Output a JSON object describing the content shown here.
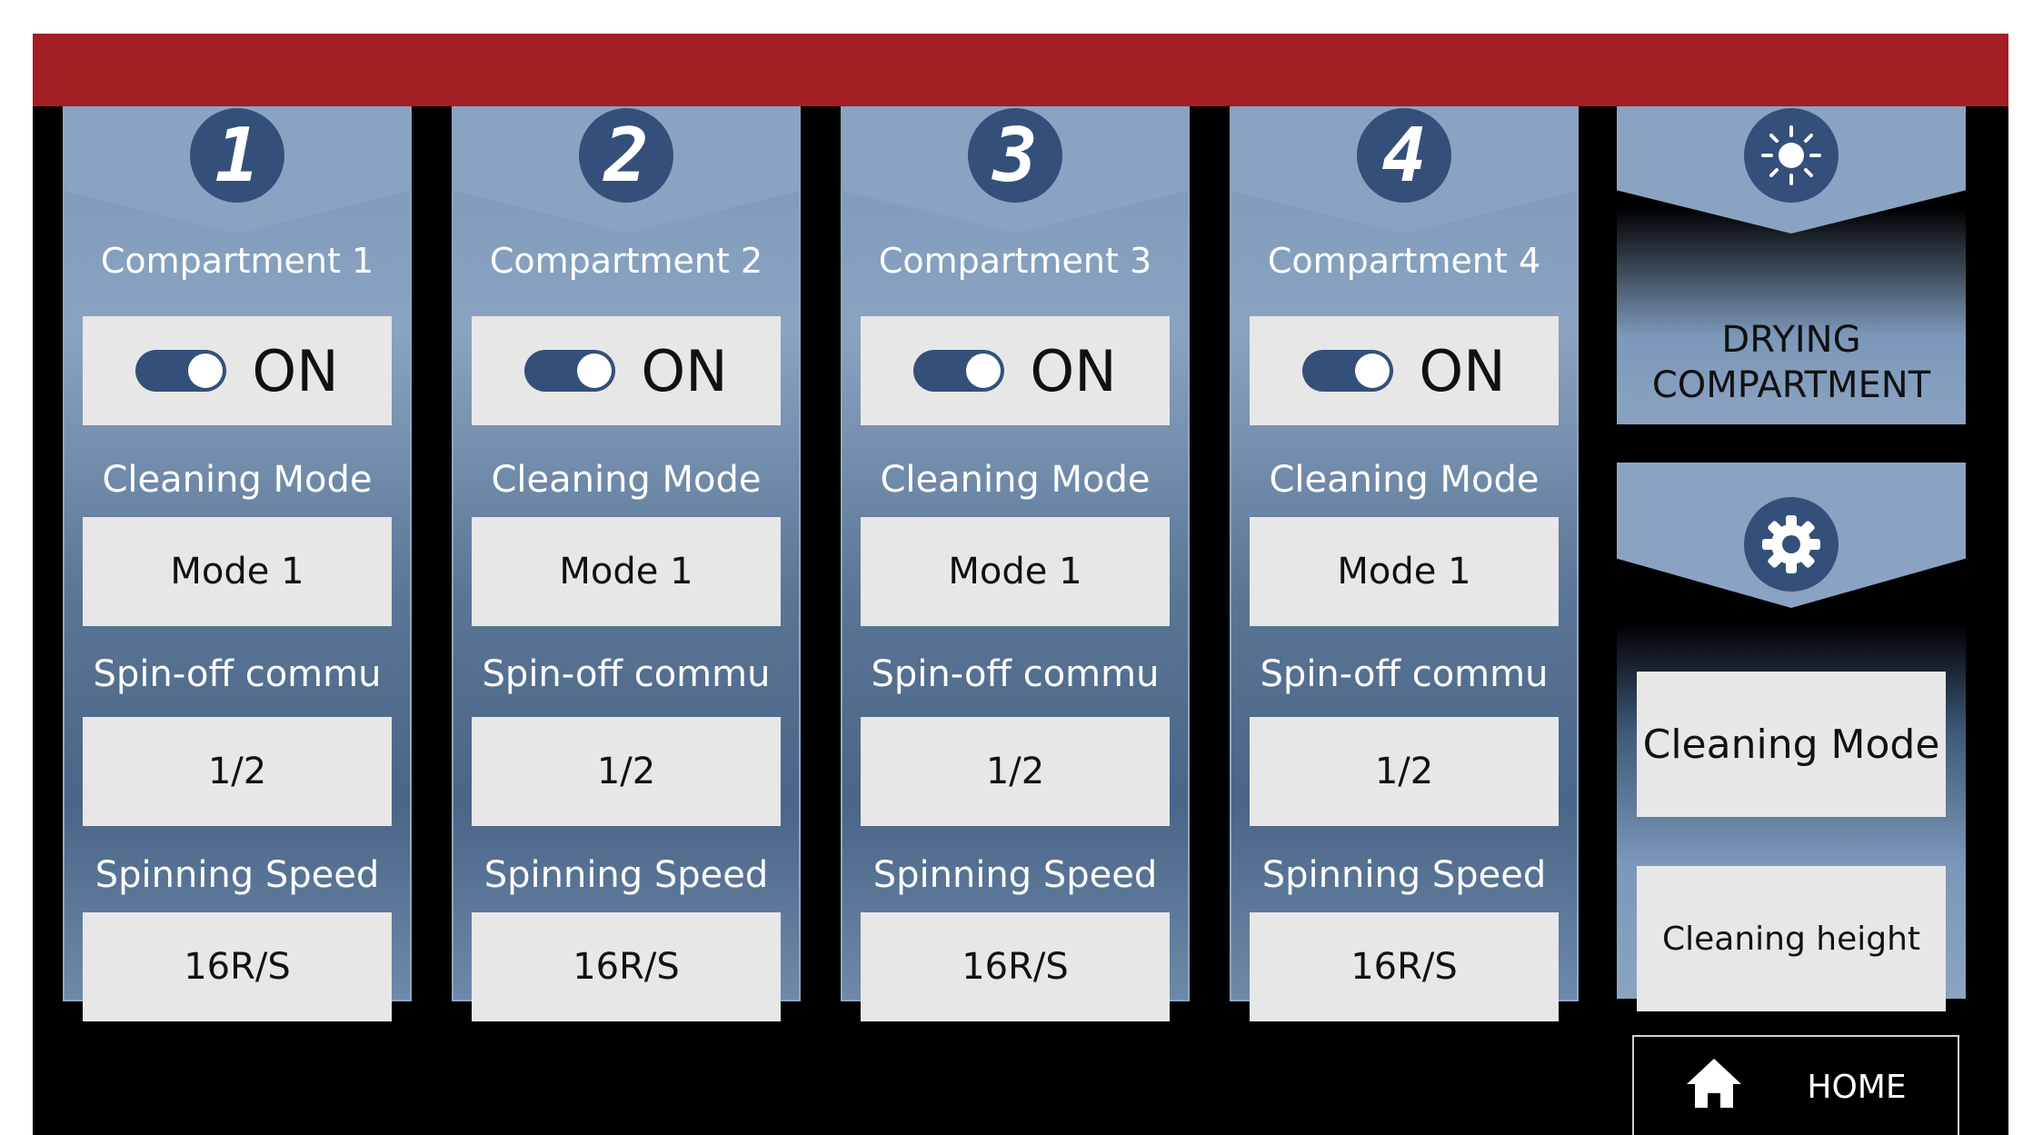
{
  "compartments": [
    {
      "number": "1",
      "title": "Compartment 1",
      "toggle": "ON",
      "mode_label": "Cleaning Mode",
      "mode": "Mode 1",
      "spin_label": "Spin-off  commu",
      "spin": "1/2",
      "speed_label": "Spinning Speed",
      "speed": "16R/S"
    },
    {
      "number": "2",
      "title": "Compartment 2",
      "toggle": "ON",
      "mode_label": "Cleaning Mode",
      "mode": "Mode 1",
      "spin_label": "Spin-off  commu",
      "spin": "1/2",
      "speed_label": "Spinning Speed",
      "speed": "16R/S"
    },
    {
      "number": "3",
      "title": "Compartment 3",
      "toggle": "ON",
      "mode_label": "Cleaning Mode",
      "mode": "Mode 1",
      "spin_label": "Spin-off  commu",
      "spin": "1/2",
      "speed_label": "Spinning Speed",
      "speed": "16R/S"
    },
    {
      "number": "4",
      "title": "Compartment 4",
      "toggle": "ON",
      "mode_label": "Cleaning Mode",
      "mode": "Mode 1",
      "spin_label": "Spin-off  commu",
      "spin": "1/2",
      "speed_label": "Spinning Speed",
      "speed": "16R/S"
    }
  ],
  "drying": {
    "line1": "DRYING",
    "line2": "COMPARTMENT",
    "icon": "sun-icon"
  },
  "settings": {
    "icon": "gear-icon",
    "cleaning_mode": "Cleaning Mode",
    "cleaning_height": "Cleaning  height"
  },
  "home": {
    "label": "HOME",
    "icon": "home-icon"
  },
  "colors": {
    "top_bar": "#a41e25",
    "panel": "#8aa3c2",
    "badge": "#34507a",
    "box": "#e7e7e7"
  }
}
